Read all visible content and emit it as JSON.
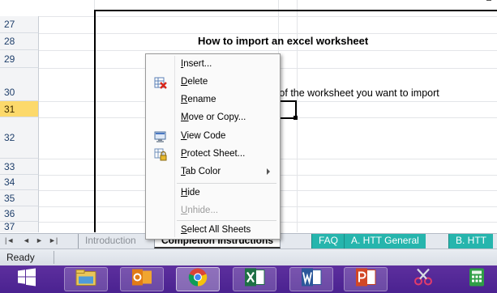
{
  "grid": {
    "rows": [
      {
        "num": "27",
        "selected": false
      },
      {
        "num": "28",
        "selected": false
      },
      {
        "num": "29",
        "selected": false
      },
      {
        "num": "30",
        "selected": false
      },
      {
        "num": "31",
        "selected": true
      },
      {
        "num": "32",
        "selected": false
      },
      {
        "num": "33",
        "selected": false
      },
      {
        "num": "34",
        "selected": false
      },
      {
        "num": "35",
        "selected": false
      },
      {
        "num": "36",
        "selected": false
      },
      {
        "num": "37",
        "selected": false
      }
    ],
    "title": "How to import an excel worksheet",
    "step_text": "g of the worksheet you want to import"
  },
  "context_menu": {
    "items": [
      {
        "label": "Insert...",
        "underline_index": 0,
        "icon": "",
        "disabled": false,
        "submenu": false
      },
      {
        "label": "Delete",
        "underline_index": 0,
        "icon": "delete-sheet-icon",
        "disabled": false,
        "submenu": false
      },
      {
        "label": "Rename",
        "underline_index": 0,
        "icon": "",
        "disabled": false,
        "submenu": false
      },
      {
        "label": "Move or Copy...",
        "underline_index": 0,
        "icon": "",
        "disabled": false,
        "submenu": false
      },
      {
        "label": "View Code",
        "underline_index": 0,
        "icon": "view-code-icon",
        "disabled": false,
        "submenu": false
      },
      {
        "label": "Protect Sheet...",
        "underline_index": 0,
        "icon": "protect-sheet-icon",
        "disabled": false,
        "submenu": false
      },
      {
        "label": "Tab Color",
        "underline_index": 0,
        "icon": "",
        "disabled": false,
        "submenu": true
      },
      {
        "label": "Hide",
        "underline_index": 0,
        "icon": "",
        "disabled": false,
        "submenu": false
      },
      {
        "label": "Unhide...",
        "underline_index": 0,
        "icon": "",
        "disabled": true,
        "submenu": false
      },
      {
        "label": "Select All Sheets",
        "underline_index": 0,
        "icon": "",
        "disabled": false,
        "submenu": false
      }
    ]
  },
  "tabbar": {
    "nav": [
      "|◄",
      "◄",
      "►",
      "►|"
    ],
    "tabs": [
      {
        "label": "Introduction",
        "active": false
      },
      {
        "label": "Completion Instructions",
        "active": true
      },
      {
        "label": "FAQ",
        "active": false
      },
      {
        "label": "A. HTT General",
        "active": false
      },
      {
        "label": "B. HTT",
        "active": false
      }
    ],
    "tab_color": "#26b5ad"
  },
  "status": {
    "ready": "Ready"
  },
  "taskbar": {
    "colors": {
      "background": "#4a2290"
    },
    "buttons": [
      {
        "icon": "windows-start-icon",
        "state": "plain"
      },
      {
        "icon": "file-explorer-icon",
        "state": "on"
      },
      {
        "icon": "outlook-icon",
        "state": "on"
      },
      {
        "icon": "chrome-icon",
        "state": "active"
      },
      {
        "icon": "excel-icon",
        "state": "on"
      },
      {
        "icon": "word-icon",
        "state": "on"
      },
      {
        "icon": "powerpoint-icon",
        "state": "on"
      },
      {
        "icon": "snipping-tool-icon",
        "state": "plain"
      },
      {
        "icon": "calculator-icon",
        "state": "plain"
      }
    ]
  }
}
